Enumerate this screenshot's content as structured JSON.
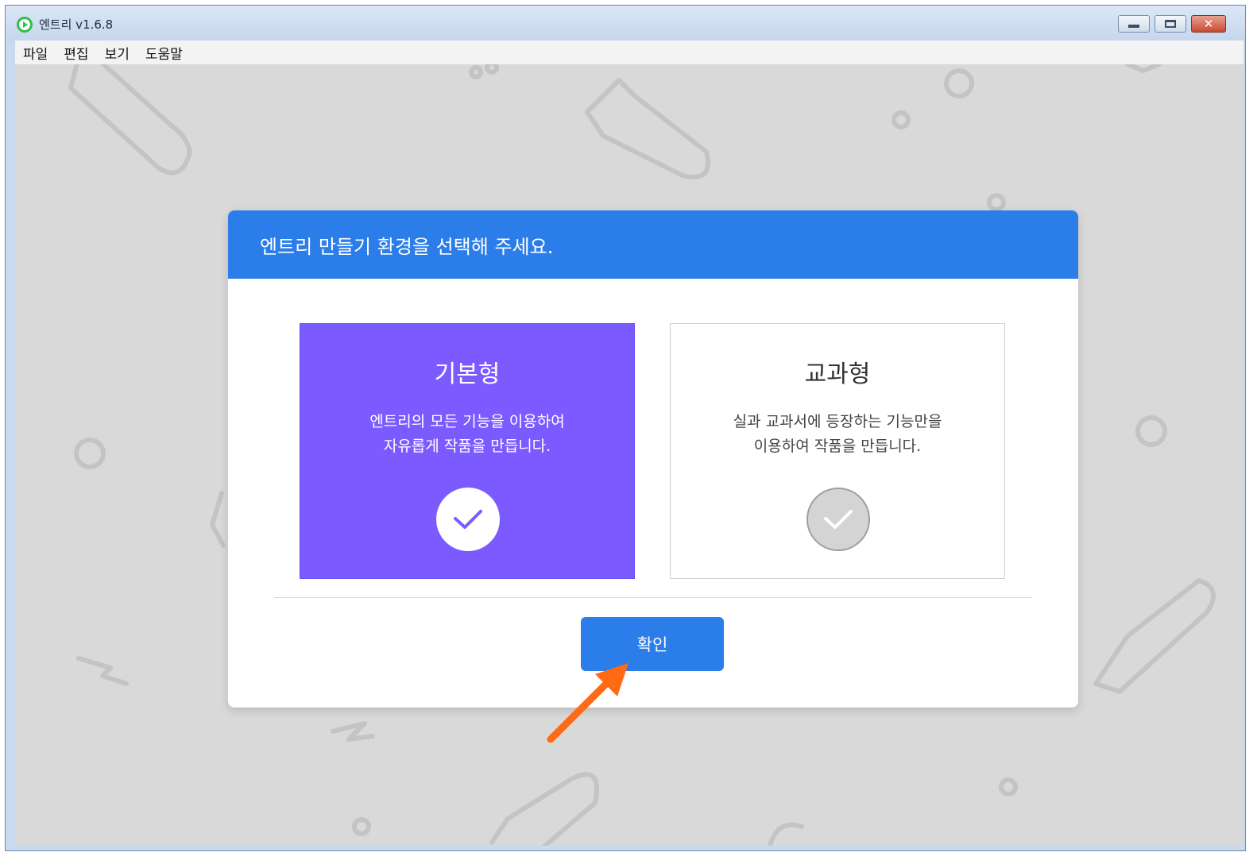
{
  "window": {
    "title": "엔트리 v1.6.8",
    "app_icon": "entry-logo-icon",
    "controls": {
      "minimize": "minimize-icon",
      "maximize": "maximize-icon",
      "close": "close-icon",
      "close_glyph": "✕"
    }
  },
  "menubar": {
    "items": [
      {
        "label": "파일"
      },
      {
        "label": "편집"
      },
      {
        "label": "보기"
      },
      {
        "label": "도움말"
      }
    ]
  },
  "dialog": {
    "title": "엔트리 만들기 환경을 선택해 주세요.",
    "options": [
      {
        "title": "기본형",
        "desc_line1": "엔트리의 모든 기능을 이용하여",
        "desc_line2": "자유롭게 작품을 만듭니다.",
        "selected": true,
        "icon": "check-circle-icon"
      },
      {
        "title": "교과형",
        "desc_line1": "실과 교과서에 등장하는 기능만을",
        "desc_line2": "이용하여 작품을 만듭니다.",
        "selected": false,
        "icon": "check-circle-icon"
      }
    ],
    "confirm_label": "확인"
  },
  "colors": {
    "header_blue": "#2b7de9",
    "selected_purple": "#7b5bff",
    "background_gray": "#d9d9d9",
    "annotation_orange": "#ff6a13"
  }
}
